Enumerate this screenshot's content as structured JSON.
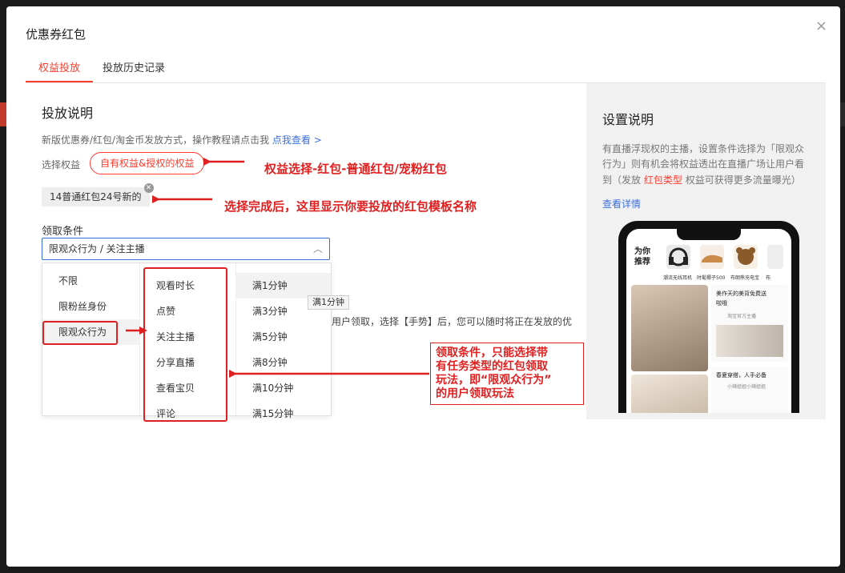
{
  "modal": {
    "title": "优惠券红包",
    "close": "×",
    "tabs": [
      {
        "label": "权益投放",
        "active": true
      },
      {
        "label": "投放历史记录",
        "active": false
      }
    ]
  },
  "main": {
    "heading": "投放说明",
    "intro": "新版优惠券/红包/淘金币发放方式，操作教程请点击我",
    "intro_link": "点我查看 >",
    "select_label": "选择权益",
    "select_button": "自有权益&授权的权益",
    "selected_tag": "14普通红包24号新的",
    "condition_label": "领取条件",
    "condition_value": "限观众行为 / 关注主播",
    "cascader": {
      "col1": [
        "不限",
        "限粉丝身份",
        "限观众行为"
      ],
      "col2": [
        "观看时长",
        "点赞",
        "关注主播",
        "分享直播",
        "查看宝贝",
        "评论"
      ],
      "col3": [
        "满1分钟",
        "满3分钟",
        "满5分钟",
        "满8分钟",
        "满10分钟",
        "满15分钟"
      ]
    },
    "tooltip": "满1分钟",
    "behind_text": "用户领取，选择【手势】后，您可以随时将正在发放的优"
  },
  "annotations": {
    "a1": "权益选择-红包-普通红包/宠粉红包",
    "a2": "选择完成后，这里显示你要投放的红包模板名称",
    "a3_lines": [
      "领取条件，只能选择带",
      "有任务类型的红包领取",
      "玩法，即“限观众行为”",
      "的用户领取玩法"
    ]
  },
  "side": {
    "heading": "设置说明",
    "desc1": "有直播浮现权的主播，设置条件选择为「限观众",
    "desc2": "行为」则有机会将权益透出在直播广场让用户看",
    "desc3_pre": "到（发放",
    "desc3_link": "红包类型",
    "desc3_post": "权益可获得更多流量曝光）",
    "details_link": "查看详情",
    "phone": {
      "title": "为你推荐",
      "items": [
        "潮流无线耳机",
        "时髦椰子500",
        "布朗熊充电宝",
        "布"
      ],
      "card1_title": "美作天的美背免费送",
      "card1_sub": "啦哦",
      "card1_shop": "淘宝官方主播",
      "card2_title": "春夏穿搭，人手必备",
      "card2_shop": "小辣姐姐小辣姐姐"
    }
  },
  "colors": {
    "accent": "#ff3d2e",
    "link": "#3a6fe0",
    "annotation": "#e02020"
  }
}
